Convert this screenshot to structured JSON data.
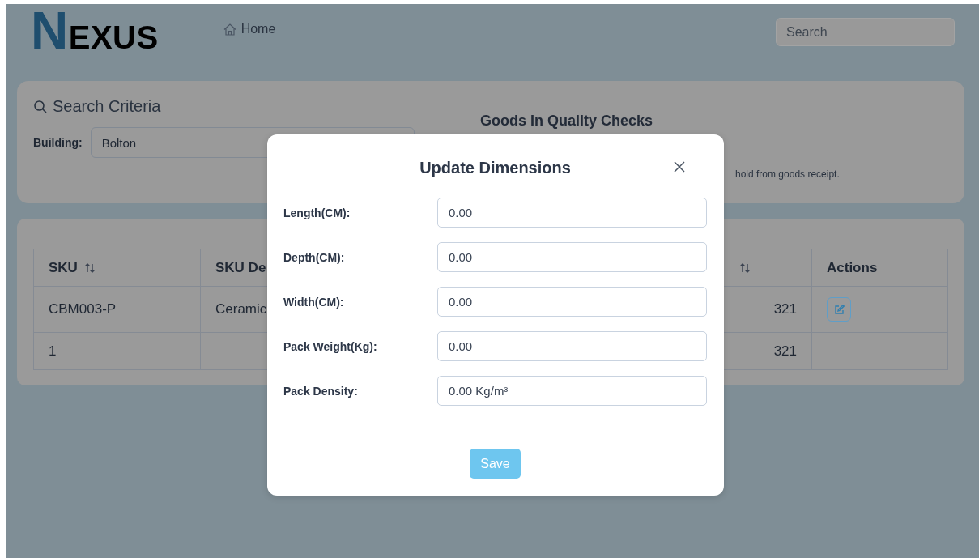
{
  "header": {
    "logo": "NEXUS",
    "nav": [
      {
        "label": "Home"
      }
    ],
    "search": {
      "placeholder": "Search"
    }
  },
  "search_criteria": {
    "title": "Search Criteria",
    "building": {
      "label": "Building:",
      "value": "Bolton"
    },
    "heading": "Goods In Quality Checks",
    "note": "hold from goods receipt."
  },
  "table": {
    "columns": [
      {
        "label": "SKU",
        "sortable": true
      },
      {
        "label": "SKU De"
      },
      {
        "sortable": true
      },
      {
        "label": "Actions",
        "sortable": false
      }
    ],
    "rows": [
      {
        "cells": [
          "CBM003-P",
          "Ceramic",
          "321"
        ],
        "editable": true
      },
      {
        "cells": [
          "1",
          null,
          "321"
        ],
        "editable": false
      }
    ]
  },
  "modal": {
    "title": "Update Dimensions",
    "fields": [
      {
        "label": "Length(CM):",
        "value": "0.00"
      },
      {
        "label": "Depth(CM):",
        "value": "0.00"
      },
      {
        "label": "Width(CM):",
        "value": "0.00"
      },
      {
        "label": "Pack Weight(Kg):",
        "value": "0.00"
      },
      {
        "label": "Pack Density:",
        "value": "0.00 Kg/m³"
      }
    ],
    "save_button": {
      "label": "Save",
      "disabled": true
    }
  }
}
